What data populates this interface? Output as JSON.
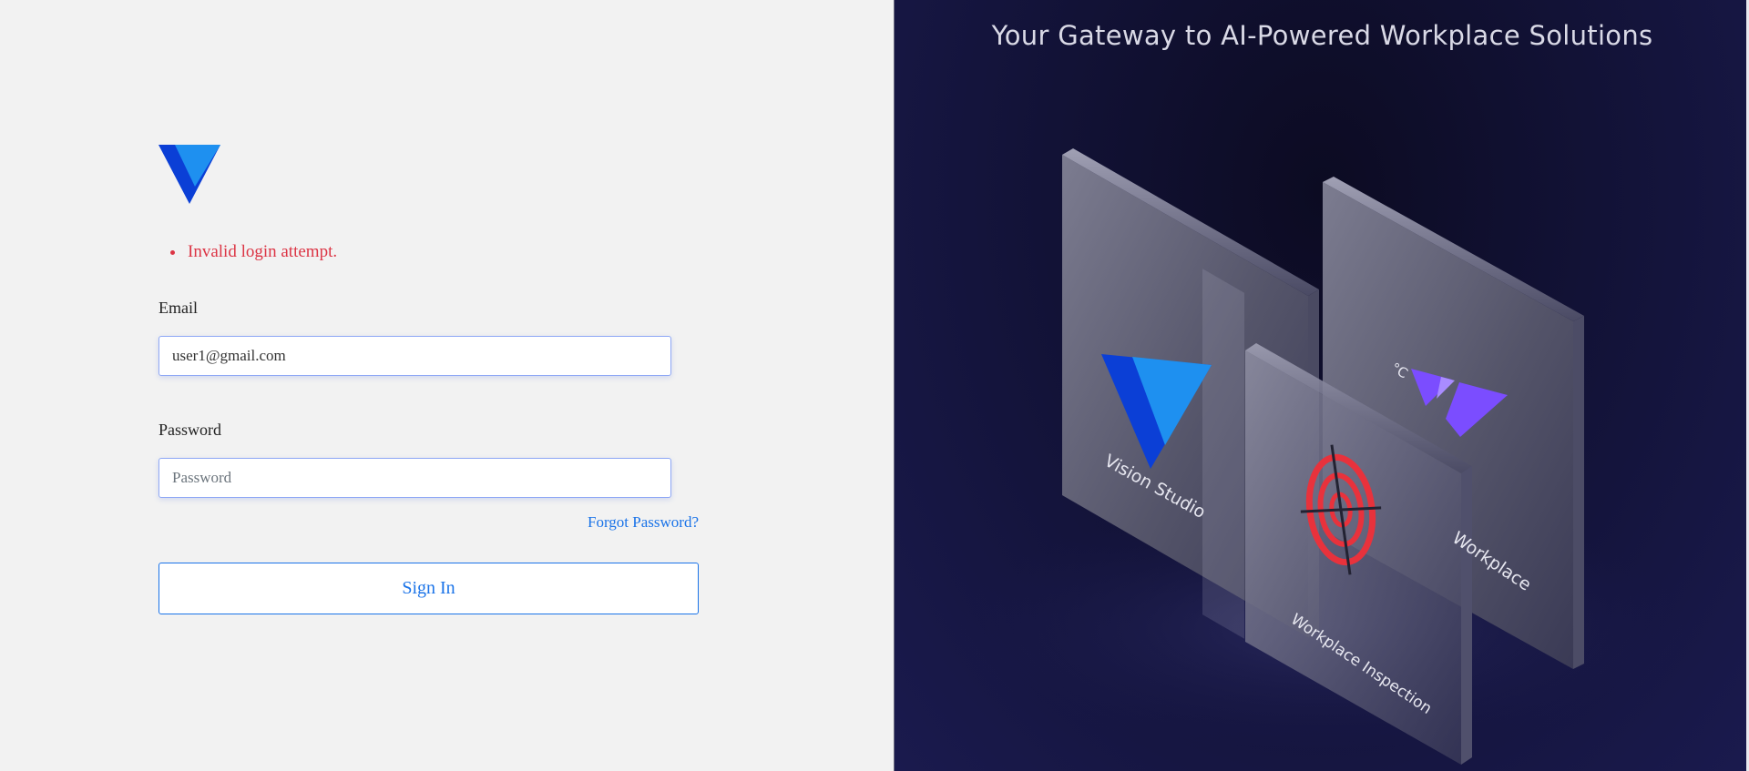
{
  "login": {
    "errors": [
      "Invalid login attempt."
    ],
    "email": {
      "label": "Email",
      "value": "user1@gmail.com"
    },
    "password": {
      "label": "Password",
      "placeholder": "Password",
      "value": ""
    },
    "forgot_password": "Forgot Password?",
    "sign_in": "Sign In"
  },
  "hero": {
    "tagline": "Your Gateway to AI-Powered Workplace Solutions",
    "panels": [
      {
        "label": "Vision Studio",
        "icon": "vision-studio-logo-icon"
      },
      {
        "label": "Workplace Inspection",
        "icon": "target-icon"
      },
      {
        "label": "Workplace",
        "icon": "workplace-logo-icon"
      }
    ],
    "temperature_symbol": "°C"
  },
  "colors": {
    "error": "#dc3545",
    "accent": "#1a73e8",
    "left_background": "#f2f2f2",
    "right_background": "#141438",
    "logo_dark": "#0b3fd6",
    "logo_light": "#1e90f0",
    "workplace_purple": "#7b4dff",
    "target_red": "#e8323c"
  }
}
